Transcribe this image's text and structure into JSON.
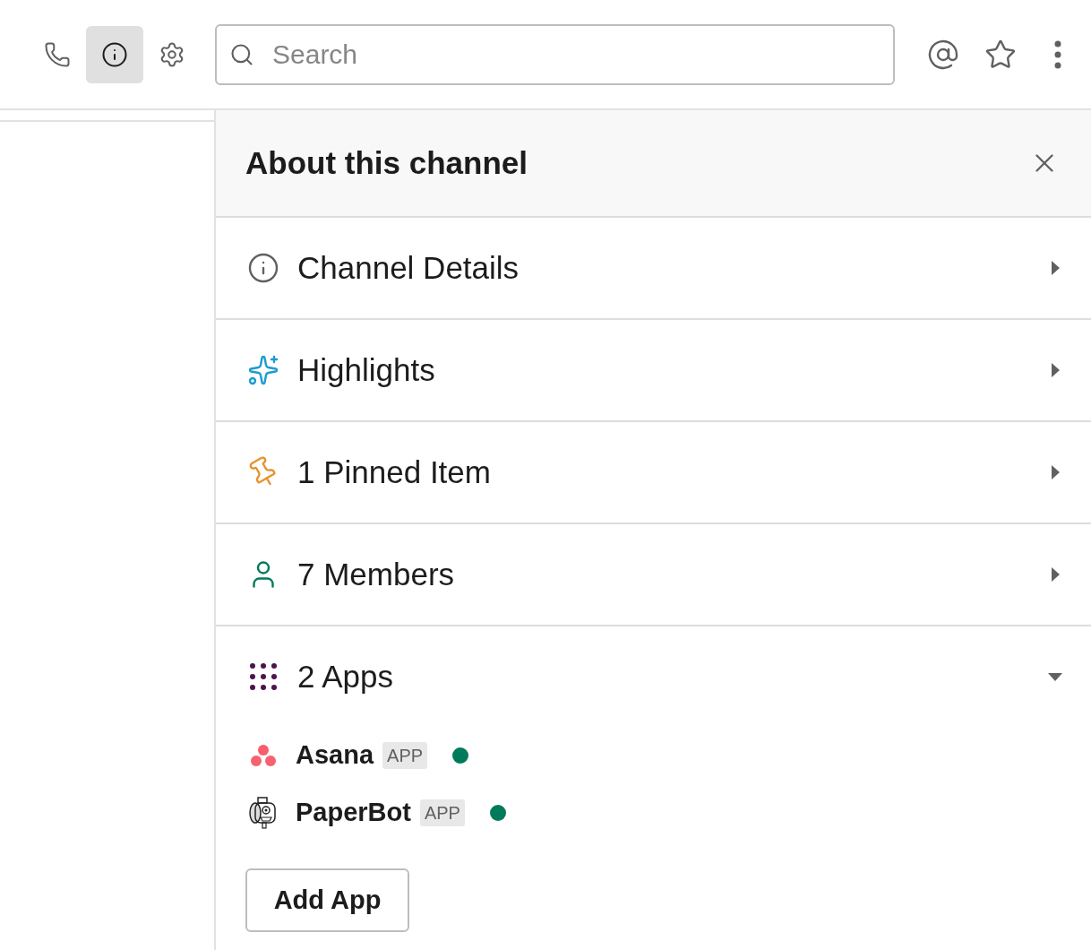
{
  "toolbar": {
    "buttons": [
      {
        "kind": "phone",
        "selected": false
      },
      {
        "kind": "info",
        "selected": true
      },
      {
        "kind": "settings",
        "selected": false
      }
    ],
    "search": {
      "placeholder": "Search"
    },
    "right_buttons": [
      {
        "kind": "mention"
      },
      {
        "kind": "star"
      },
      {
        "kind": "more"
      }
    ]
  },
  "panel": {
    "title": "About this channel",
    "sections": [
      {
        "kind": "details",
        "label": "Channel Details",
        "expanded": false
      },
      {
        "kind": "highlights",
        "label": "Highlights",
        "expanded": false
      },
      {
        "kind": "pinned",
        "label": "1 Pinned Item",
        "expanded": false
      },
      {
        "kind": "members",
        "label": "7 Members",
        "expanded": false
      },
      {
        "kind": "apps",
        "label": "2 Apps",
        "expanded": true
      }
    ],
    "apps": [
      {
        "kind": "asana",
        "name": "Asana",
        "badge": "APP",
        "online": true
      },
      {
        "kind": "paperbot",
        "name": "PaperBot",
        "badge": "APP",
        "online": true
      }
    ],
    "add_button": "Add App"
  }
}
